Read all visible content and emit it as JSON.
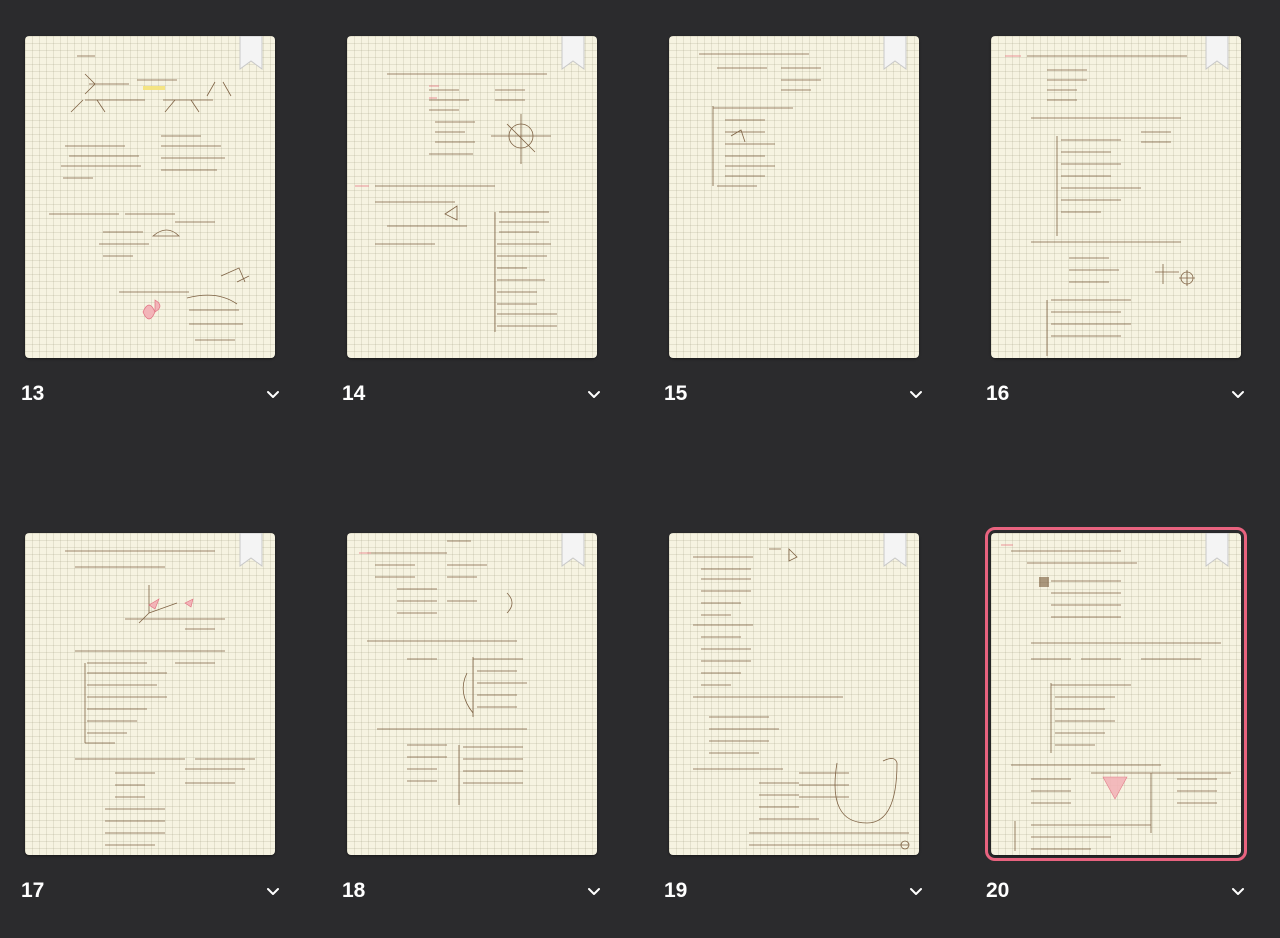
{
  "thumbnails": [
    {
      "page": "13",
      "selected": false
    },
    {
      "page": "14",
      "selected": false
    },
    {
      "page": "15",
      "selected": false
    },
    {
      "page": "16",
      "selected": false
    },
    {
      "page": "17",
      "selected": false
    },
    {
      "page": "18",
      "selected": false
    },
    {
      "page": "19",
      "selected": false
    },
    {
      "page": "20",
      "selected": true
    }
  ],
  "colors": {
    "background": "#2b2b2d",
    "paper": "#f6f3e1",
    "ink": "#6b4a2a",
    "selection": "#e8637f",
    "section_marker": "#e8737f"
  },
  "icons": [
    "bookmark-icon",
    "chevron-down-icon"
  ]
}
